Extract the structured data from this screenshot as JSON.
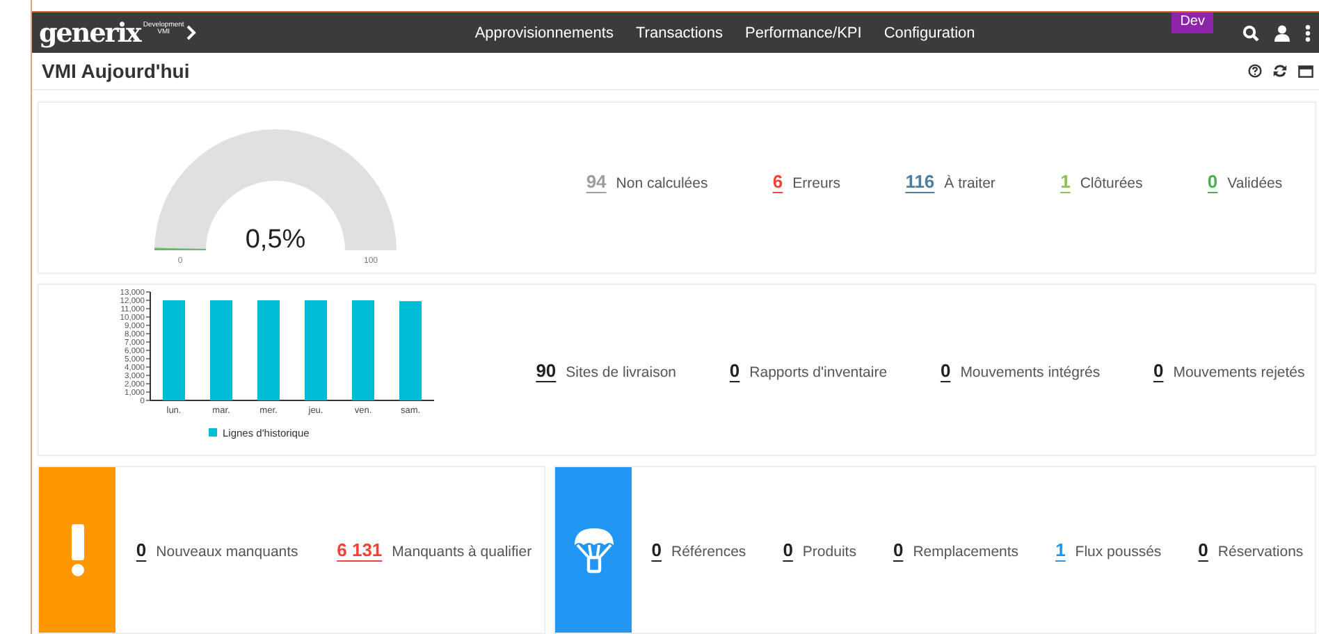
{
  "topbar": {
    "logo": "generix",
    "logo_sub": [
      "Development",
      "VMI"
    ],
    "menu": [
      "Approvisionnements",
      "Transactions",
      "Performance/KPI",
      "Configuration"
    ],
    "env_badge": "Dev"
  },
  "page": {
    "title": "VMI Aujourd'hui"
  },
  "summary": {
    "gauge": {
      "value": "0,5%",
      "min": "0",
      "max": "100"
    },
    "stats": [
      {
        "value": "94",
        "label": "Non calculées",
        "color": "#9e9e9e"
      },
      {
        "value": "6",
        "label": "Erreurs",
        "color": "#f44336"
      },
      {
        "value": "116",
        "label": "À traiter",
        "color": "#4f7f9c"
      },
      {
        "value": "1",
        "label": "Clôturées",
        "color": "#8bc34a"
      },
      {
        "value": "0",
        "label": "Validées",
        "color": "#4caf50"
      }
    ]
  },
  "activity": {
    "chart_data": {
      "type": "bar",
      "categories": [
        "lun.",
        "mar.",
        "mer.",
        "jeu.",
        "ven.",
        "sam."
      ],
      "series": [
        {
          "name": "Lignes d'historique",
          "color": "#00bcd4",
          "values": [
            12000,
            12000,
            12000,
            12000,
            12000,
            11900
          ]
        }
      ],
      "ylim": [
        0,
        13000
      ],
      "yticks": [
        {
          "value": 0,
          "label": "0"
        },
        {
          "value": 1000,
          "label": "1,000"
        },
        {
          "value": 2000,
          "label": "2,000"
        },
        {
          "value": 3000,
          "label": "3,000"
        },
        {
          "value": 4000,
          "label": "4,000"
        },
        {
          "value": 5000,
          "label": "5,000"
        },
        {
          "value": 6000,
          "label": "6,000"
        },
        {
          "value": 7000,
          "label": "7,000"
        },
        {
          "value": 8000,
          "label": "8,000"
        },
        {
          "value": 9000,
          "label": "9,000"
        },
        {
          "value": 10000,
          "label": "10,000"
        },
        {
          "value": 11000,
          "label": "11,000"
        },
        {
          "value": 12000,
          "label": "12,000"
        },
        {
          "value": 13000,
          "label": "13,000"
        }
      ]
    },
    "stats": [
      {
        "value": "90",
        "label": "Sites de livraison",
        "color": "#212121"
      },
      {
        "value": "0",
        "label": "Rapports d'inventaire",
        "color": "#212121"
      },
      {
        "value": "0",
        "label": "Mouvements intégrés",
        "color": "#212121"
      },
      {
        "value": "0",
        "label": "Mouvements rejetés",
        "color": "#212121"
      }
    ]
  },
  "tiles": [
    {
      "kind": "alert",
      "color": "#ff9800",
      "stats": [
        {
          "value": "0",
          "label": "Nouveaux manquants",
          "color": "#212121"
        },
        {
          "value": "6 131",
          "label": "Manquants à qualifier",
          "color": "#f44336"
        }
      ]
    },
    {
      "kind": "parachute",
      "color": "#2196f3",
      "stats": [
        {
          "value": "0",
          "label": "Références",
          "color": "#212121"
        },
        {
          "value": "0",
          "label": "Produits",
          "color": "#212121"
        },
        {
          "value": "0",
          "label": "Remplacements",
          "color": "#212121"
        },
        {
          "value": "1",
          "label": "Flux poussés",
          "color": "#2196f3"
        },
        {
          "value": "0",
          "label": "Réservations",
          "color": "#212121"
        }
      ]
    }
  ]
}
